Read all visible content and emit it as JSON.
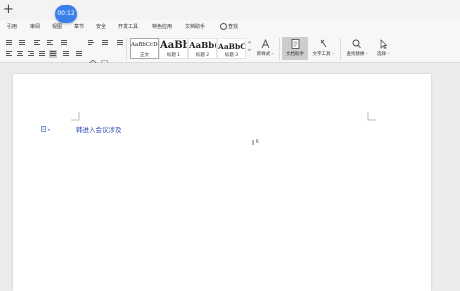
{
  "titlebar": {
    "new_tab_glyph": "+"
  },
  "recorder": {
    "time": "00:12"
  },
  "menu": {
    "items": [
      "引用",
      "审阅",
      "视图",
      "章节",
      "安全",
      "开发工具",
      "特色应用",
      "文档助手",
      "查找"
    ]
  },
  "styles": {
    "items": [
      {
        "preview": "AaBbCcDd",
        "name": "正文"
      },
      {
        "preview": "AaBb",
        "name": "标题 1"
      },
      {
        "preview": "AaBb(",
        "name": "标题 2"
      },
      {
        "preview": "AaBbC(",
        "name": "标题 3"
      }
    ]
  },
  "tools": {
    "new_style": "新样式 -",
    "doc_assistant": "文档助手",
    "text_tools": "文字工具 -",
    "find_replace": "查找替换 -",
    "select": "选择 -"
  },
  "document": {
    "paragraph_marker": "▾",
    "text": "韩进入会议涉及",
    "cursor": "I",
    "cursor_mark": "R"
  },
  "colors": {
    "accent": "#3b80ea",
    "doc_text": "#2a48b8",
    "page": "#ffffff",
    "background": "#ececec"
  }
}
